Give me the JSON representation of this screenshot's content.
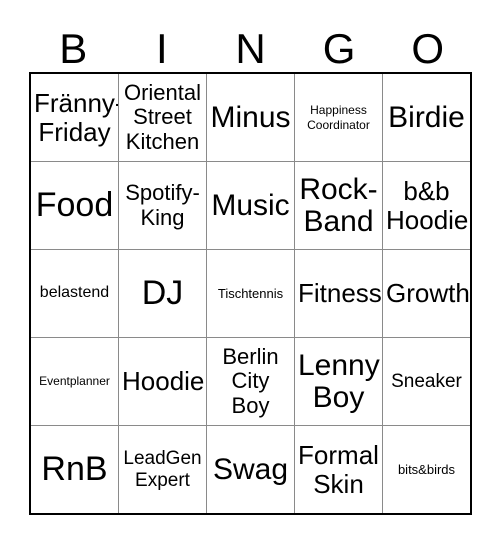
{
  "card": {
    "title_letters": [
      "B",
      "I",
      "N",
      "G",
      "O"
    ],
    "columns": 5,
    "rows": 5,
    "colors": {
      "outer_border": "#000000",
      "inner_border": "#8a8a8a",
      "cell_background": "#ffffff",
      "text": "#000000"
    },
    "cells": [
      [
        {
          "text": "Fränny-\nFriday",
          "size": "fs-2xl"
        },
        {
          "text": "Oriental\nStreet\nKitchen",
          "size": "fs-xl"
        },
        {
          "text": "Minus",
          "size": "fs-3xl"
        },
        {
          "text": "Happiness\nCoordinator",
          "size": "fs-xs"
        },
        {
          "text": "Birdie",
          "size": "fs-3xl"
        }
      ],
      [
        {
          "text": "Food",
          "size": "fs-4xl"
        },
        {
          "text": "Spotify-\nKing",
          "size": "fs-xl"
        },
        {
          "text": "Music",
          "size": "fs-3xl"
        },
        {
          "text": "Rock-\nBand",
          "size": "fs-3xl"
        },
        {
          "text": "b&b\nHoodie",
          "size": "fs-2xl"
        }
      ],
      [
        {
          "text": "belastend",
          "size": "fs-md"
        },
        {
          "text": "DJ",
          "size": "fs-4xl"
        },
        {
          "text": "Tischtennis",
          "size": "fs-sm"
        },
        {
          "text": "Fitness",
          "size": "fs-2xl"
        },
        {
          "text": "Growth",
          "size": "fs-2xl"
        }
      ],
      [
        {
          "text": "Eventplanner",
          "size": "fs-xs"
        },
        {
          "text": "Hoodie",
          "size": "fs-2xl"
        },
        {
          "text": "Berlin\nCity\nBoy",
          "size": "fs-xl"
        },
        {
          "text": "Lenny\nBoy",
          "size": "fs-3xl"
        },
        {
          "text": "Sneaker",
          "size": "fs-lg"
        }
      ],
      [
        {
          "text": "RnB",
          "size": "fs-4xl"
        },
        {
          "text": "LeadGen\nExpert",
          "size": "fs-lg"
        },
        {
          "text": "Swag",
          "size": "fs-3xl"
        },
        {
          "text": "Formal\nSkin",
          "size": "fs-2xl"
        },
        {
          "text": "bits&birds",
          "size": "fs-sm"
        }
      ]
    ]
  }
}
